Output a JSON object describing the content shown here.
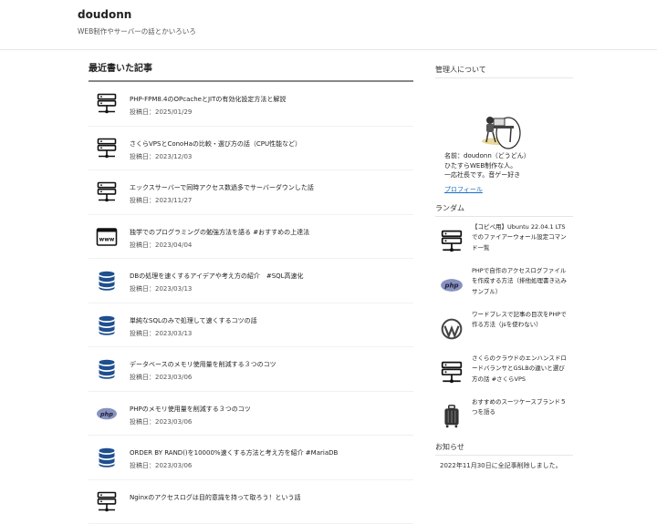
{
  "header": {
    "site_title": "doudonn",
    "tagline": "WEB制作やサーバーの話とかいろいろ"
  },
  "main": {
    "section_title": "最近書いた記事",
    "posts": [
      {
        "title": "PHP-FPM8.4のOPcacheとJITの有効化設定方法と解説",
        "date": "投稿日：2025/01/29",
        "icon": "server-icon"
      },
      {
        "title": "さくらVPSとConoHaの比較・選び方の話（CPU性能など）",
        "date": "投稿日：2023/12/03",
        "icon": "server-icon"
      },
      {
        "title": "エックスサーバーで同時アクセス数過多でサーバーダウンした話",
        "date": "投稿日：2023/11/27",
        "icon": "server-icon"
      },
      {
        "title": "独学でのプログラミングの勉強方法を語る #おすすめの上達法",
        "date": "投稿日：2023/04/04",
        "icon": "www-icon"
      },
      {
        "title": "DBの処理を速くするアイデアや考え方の紹介　#SQL高速化",
        "date": "投稿日：2023/03/13",
        "icon": "database-icon"
      },
      {
        "title": "単純なSQLのみで処理して速くするコツの話",
        "date": "投稿日：2023/03/13",
        "icon": "database-icon"
      },
      {
        "title": "データベースのメモリ使用量を削減する３つのコツ",
        "date": "投稿日：2023/03/06",
        "icon": "database-icon"
      },
      {
        "title": "PHPのメモリ使用量を削減する３つのコツ",
        "date": "投稿日：2023/03/06",
        "icon": "php-icon"
      },
      {
        "title": "ORDER BY RAND()を10000%速くする方法と考え方を紹介 #MariaDB",
        "date": "投稿日：2023/03/06",
        "icon": "database-icon"
      },
      {
        "title": "Nginxのアクセスログは目的意識を持って取ろう！という話",
        "date": "",
        "icon": "server-icon"
      }
    ]
  },
  "sidebar": {
    "about_title": "管理人について",
    "profile_lines": [
      "名前：doudonn（どうどん）",
      "ひたすらWEB制作な人。",
      "一応社長です。音ゲー好き"
    ],
    "profile_link": "プロフィール",
    "random_title": "ランダム",
    "random_posts": [
      {
        "title": "【コピペ用】Ubuntu 22.04.1 LTSでのファイアーウォール設定コマンド一覧",
        "icon": "server-icon"
      },
      {
        "title": "PHPで自作のアクセスログファイルを作成する方法（排他処理書き込みサンプル）",
        "icon": "php-icon"
      },
      {
        "title": "ワードプレスで記事の目次をPHPで作る方法（jsを使わない）",
        "icon": "wordpress-icon"
      },
      {
        "title": "さくらのクラウドのエンハンスドロードバランサとGSLBの違いと選び方の話 #さくらVPS",
        "icon": "server-icon"
      },
      {
        "title": "おすすめのスーツケースブランド５つを語る",
        "icon": "suitcase-icon"
      }
    ],
    "notice_title": "お知らせ",
    "notice_text": "2022年11月30日に全記事削除しました。"
  },
  "colors": {
    "link": "#1a6fc0",
    "database_blue": "#1f4f8f",
    "divider": "#888888"
  }
}
